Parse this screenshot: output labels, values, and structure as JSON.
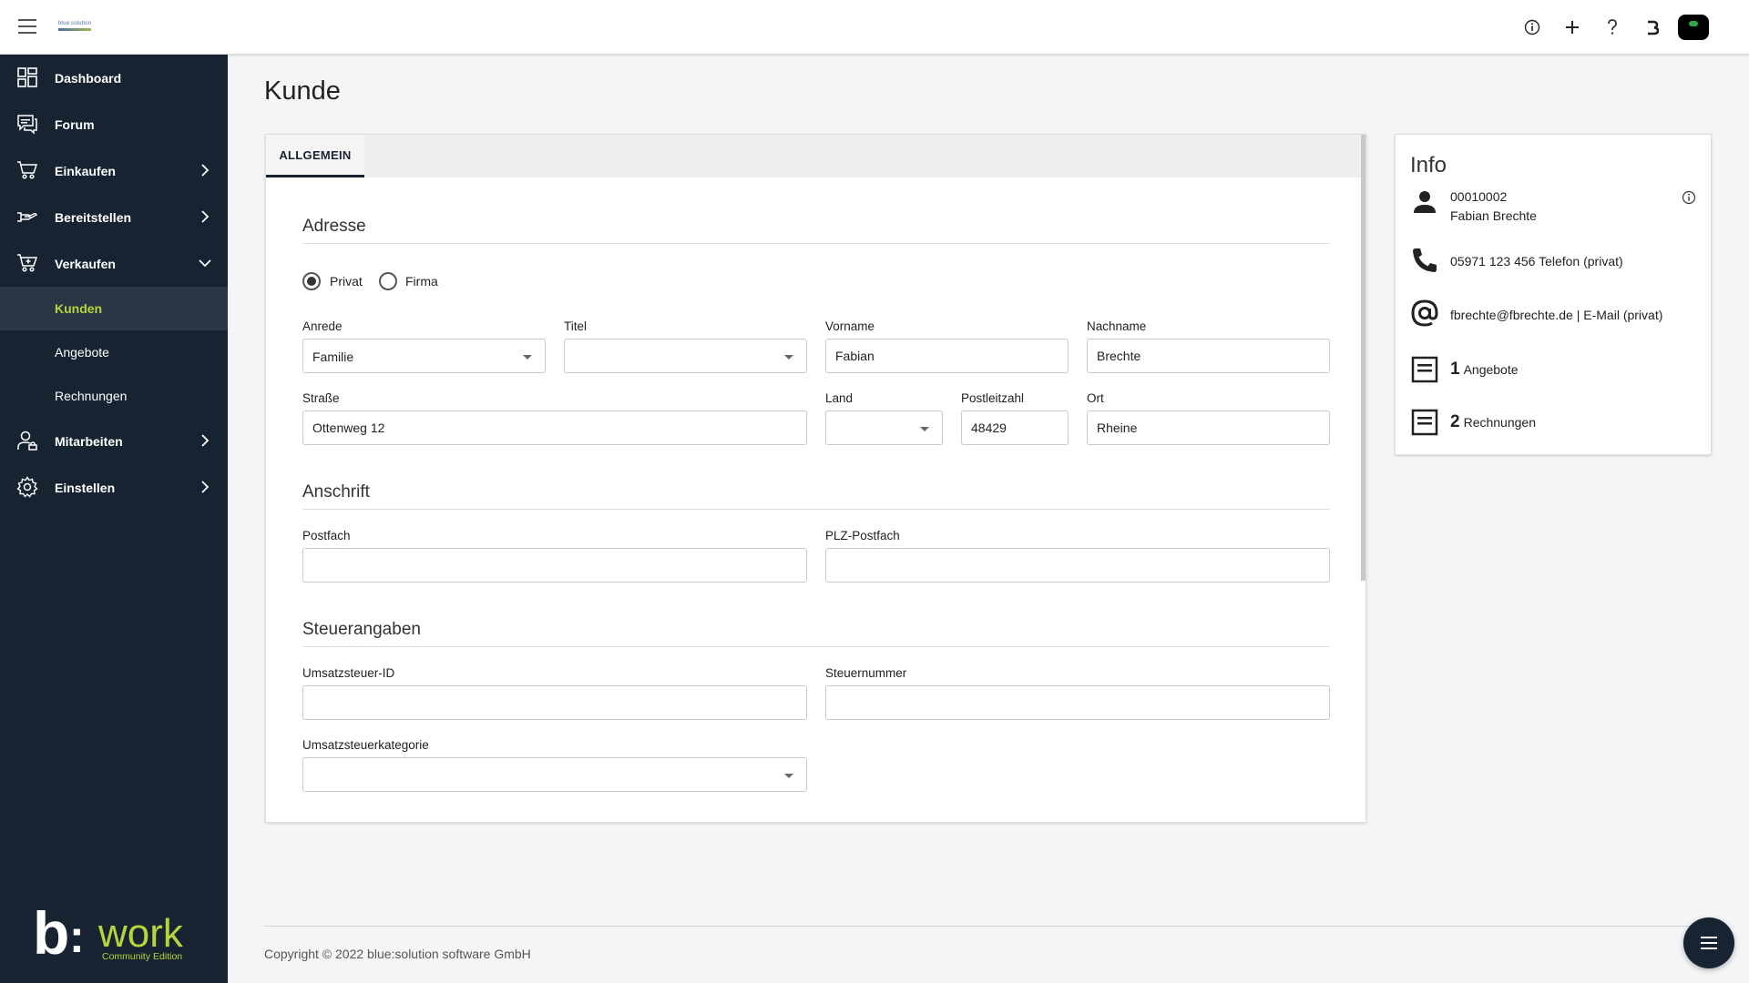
{
  "header": {
    "logo_text": "blue:solution",
    "actions": [
      "info-icon",
      "plus-icon",
      "help-icon",
      "bwork-icon",
      "avatar"
    ]
  },
  "sidebar": {
    "items": [
      {
        "label": "Dashboard",
        "icon": "dashboard-icon"
      },
      {
        "label": "Forum",
        "icon": "forum-icon"
      },
      {
        "label": "Einkaufen",
        "icon": "cart-icon"
      },
      {
        "label": "Bereitstellen",
        "icon": "supply-icon"
      },
      {
        "label": "Verkaufen",
        "icon": "cart-plus-icon"
      },
      {
        "label": "Mitarbeiten",
        "icon": "user-icon"
      },
      {
        "label": "Einstellen",
        "icon": "gear-icon"
      }
    ],
    "subitems": [
      {
        "label": "Kunden",
        "active": true
      },
      {
        "label": "Angebote"
      },
      {
        "label": "Rechnungen"
      }
    ],
    "brand": {
      "b": "b",
      "colon": ":",
      "work": "work",
      "edition": "Community Edition"
    }
  },
  "page": {
    "title": "Kunde"
  },
  "tabs": [
    {
      "label": "ALLGEMEIN"
    }
  ],
  "form": {
    "adresse": {
      "title": "Adresse",
      "type_options": [
        {
          "label": "Privat",
          "checked": true
        },
        {
          "label": "Firma",
          "checked": false
        }
      ],
      "anrede": {
        "label": "Anrede",
        "value": "Familie"
      },
      "titel": {
        "label": "Titel",
        "value": ""
      },
      "vorname": {
        "label": "Vorname",
        "value": "Fabian"
      },
      "nachname": {
        "label": "Nachname",
        "value": "Brechte"
      },
      "strasse": {
        "label": "Straße",
        "value": "Ottenweg 12"
      },
      "land": {
        "label": "Land",
        "value": ""
      },
      "plz": {
        "label": "Postleitzahl",
        "value": "48429"
      },
      "ort": {
        "label": "Ort",
        "value": "Rheine"
      }
    },
    "anschrift": {
      "title": "Anschrift",
      "postfach": {
        "label": "Postfach",
        "value": ""
      },
      "plz_postfach": {
        "label": "PLZ-Postfach",
        "value": ""
      }
    },
    "steuer": {
      "title": "Steuerangaben",
      "ust_id": {
        "label": "Umsatzsteuer-ID",
        "value": ""
      },
      "steuernummer": {
        "label": "Steuernummer",
        "value": ""
      },
      "ust_kategorie": {
        "label": "Umsatzsteuerkategorie",
        "value": ""
      }
    }
  },
  "info": {
    "title": "Info",
    "customer_number": "00010002",
    "customer_name": "Fabian Brechte",
    "phone": "05971 123 456 Telefon (privat)",
    "email": "fbrechte@fbrechte.de | E-Mail (privat)",
    "angebote": {
      "count": "1",
      "label": "Angebote"
    },
    "rechnungen": {
      "count": "2",
      "label": "Rechnungen"
    }
  },
  "footer": {
    "copyright": "Copyright © 2022 blue:solution software GmbH"
  },
  "colors": {
    "sidebar": "#172331",
    "accent": "#b6d43c"
  }
}
